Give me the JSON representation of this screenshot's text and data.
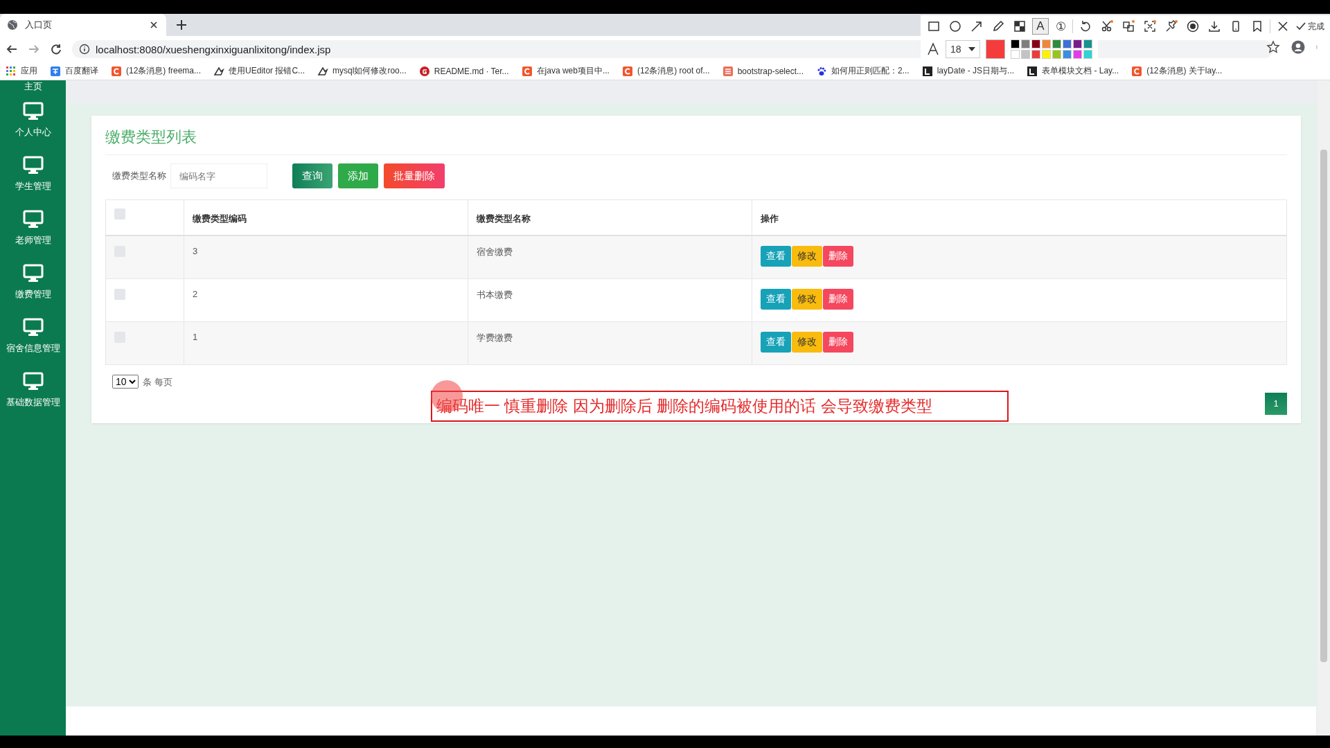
{
  "browser": {
    "tab": {
      "title": "入口页"
    },
    "address": "localhost:8080/xueshengxinxiguanlixitong/index.jsp",
    "bookmarks": [
      {
        "kind": "apps",
        "label": "应用"
      },
      {
        "kind": "translate",
        "label": "百度翻译"
      },
      {
        "kind": "csdn",
        "label": "(12条消息) freema..."
      },
      {
        "kind": "yuque",
        "label": "使用UEditor 报错C..."
      },
      {
        "kind": "yuque",
        "label": "mysql如何修改roo..."
      },
      {
        "kind": "gitee",
        "label": "README.md · Ter..."
      },
      {
        "kind": "csdn",
        "label": "在java web项目中..."
      },
      {
        "kind": "csdn",
        "label": "(12条消息) root of..."
      },
      {
        "kind": "jian",
        "label": "bootstrap-select..."
      },
      {
        "kind": "baidu",
        "label": "如何用正则匹配：2..."
      },
      {
        "kind": "layui",
        "label": "layDate - JS日期与..."
      },
      {
        "kind": "layui",
        "label": "表单模块文档 - Lay..."
      },
      {
        "kind": "csdn",
        "label": "(12条消息) 关于lay..."
      }
    ]
  },
  "capture_toolbar": {
    "tools": [
      {
        "kind": "rect",
        "selected": false
      },
      {
        "kind": "ellipse",
        "selected": false
      },
      {
        "kind": "arrow",
        "selected": false
      },
      {
        "kind": "pencil",
        "selected": false
      },
      {
        "kind": "mosaic",
        "selected": false
      },
      {
        "kind": "text",
        "label": "A",
        "selected": true
      },
      {
        "kind": "number",
        "label": "①",
        "selected": false
      },
      {
        "kind": "undo",
        "selected": false
      },
      {
        "kind": "cut",
        "selected": false
      },
      {
        "kind": "translate",
        "selected": false
      },
      {
        "kind": "expand",
        "selected": false
      },
      {
        "kind": "pin",
        "selected": false
      },
      {
        "kind": "record",
        "selected": false
      },
      {
        "kind": "download",
        "selected": false
      },
      {
        "kind": "phone",
        "selected": false
      },
      {
        "kind": "bookmark",
        "selected": false
      },
      {
        "kind": "close",
        "selected": false
      }
    ],
    "done": "完成",
    "font_size": "18",
    "palette": [
      {
        "color": "#000000"
      },
      {
        "color": "#7f7f7f"
      },
      {
        "color": "#880015"
      },
      {
        "color": "#f0883a"
      },
      {
        "color": "#2e8b3e"
      },
      {
        "color": "#3f6fd8"
      },
      {
        "color": "#7a1a8c"
      },
      {
        "color": "#16948f"
      },
      {
        "color": "#ffffff"
      },
      {
        "color": "#c3c3c3"
      },
      {
        "color": "#ed3b3b"
      },
      {
        "color": "#fff200"
      },
      {
        "color": "#9ac31c"
      },
      {
        "color": "#3a8fe0"
      },
      {
        "color": "#e23de8"
      },
      {
        "color": "#2dd5d5"
      }
    ]
  },
  "sidebar": {
    "items": [
      {
        "label": "主页"
      },
      {
        "label": "个人中心"
      },
      {
        "label": "学生管理"
      },
      {
        "label": "老师管理"
      },
      {
        "label": "缴费管理"
      },
      {
        "label": "宿舍信息管理"
      },
      {
        "label": "基础数据管理"
      }
    ]
  },
  "panel": {
    "title": "缴费类型列表",
    "search_label": "缴费类型名称",
    "search": {
      "placeholder": "编码名字"
    },
    "buttons": [
      {
        "kind": "query",
        "label": "查询"
      },
      {
        "kind": "add",
        "label": "添加"
      },
      {
        "kind": "batch_delete",
        "label": "批量删除"
      }
    ],
    "table": {
      "select_all": {
        "checked": false
      },
      "columns": [
        "缴费类型编码",
        "缴费类型名称",
        "操作"
      ],
      "rows": [
        {
          "checked": false,
          "code": "3",
          "name": "宿舍缴费",
          "actions": [
            {
              "kind": "view",
              "label": "查看"
            },
            {
              "kind": "edit",
              "label": "修改"
            },
            {
              "kind": "delete",
              "label": "删除"
            }
          ]
        },
        {
          "checked": false,
          "code": "2",
          "name": "书本缴费",
          "actions": [
            {
              "kind": "view",
              "label": "查看"
            },
            {
              "kind": "edit",
              "label": "修改"
            },
            {
              "kind": "delete",
              "label": "删除"
            }
          ]
        },
        {
          "checked": false,
          "code": "1",
          "name": "学费缴费",
          "actions": [
            {
              "kind": "view",
              "label": "查看"
            },
            {
              "kind": "edit",
              "label": "修改"
            },
            {
              "kind": "delete",
              "label": "删除"
            }
          ]
        }
      ]
    },
    "page_size": "10",
    "page_size_suffix": "条 每页",
    "pages": [
      {
        "label": "1",
        "selected": true
      }
    ]
  },
  "annotation": {
    "text": "编码唯一  慎重删除 因为删除后 删除的编码被使用的话  会导致缴费类型"
  }
}
